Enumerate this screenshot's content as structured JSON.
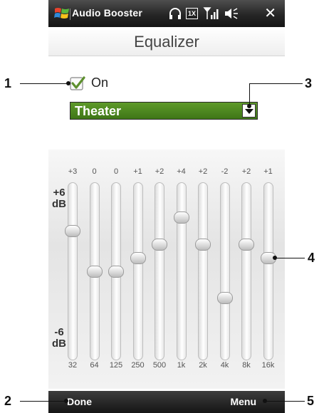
{
  "titlebar": {
    "app_title": "Audio Booster",
    "network_label": "1X"
  },
  "header": {
    "title": "Equalizer"
  },
  "settings": {
    "on_label": "On",
    "on_checked": true,
    "preset": "Theater"
  },
  "scale": {
    "top_label": "+6\ndB",
    "bottom_label": "-6\ndB",
    "range_db": [
      -6,
      6
    ]
  },
  "bands": [
    {
      "freq": "32",
      "gain": "+3"
    },
    {
      "freq": "64",
      "gain": "0"
    },
    {
      "freq": "125",
      "gain": "0"
    },
    {
      "freq": "250",
      "gain": "+1"
    },
    {
      "freq": "500",
      "gain": "+2"
    },
    {
      "freq": "1k",
      "gain": "+4"
    },
    {
      "freq": "2k",
      "gain": "+2"
    },
    {
      "freq": "4k",
      "gain": "-2"
    },
    {
      "freq": "8k",
      "gain": "+2"
    },
    {
      "freq": "16k",
      "gain": "+1"
    }
  ],
  "softkeys": {
    "left": "Done",
    "right": "Menu"
  },
  "callouts": [
    "1",
    "2",
    "3",
    "4",
    "5"
  ],
  "colors": {
    "accent_green": "#4a8a1f",
    "bar_dark": "#1a1a1a"
  }
}
